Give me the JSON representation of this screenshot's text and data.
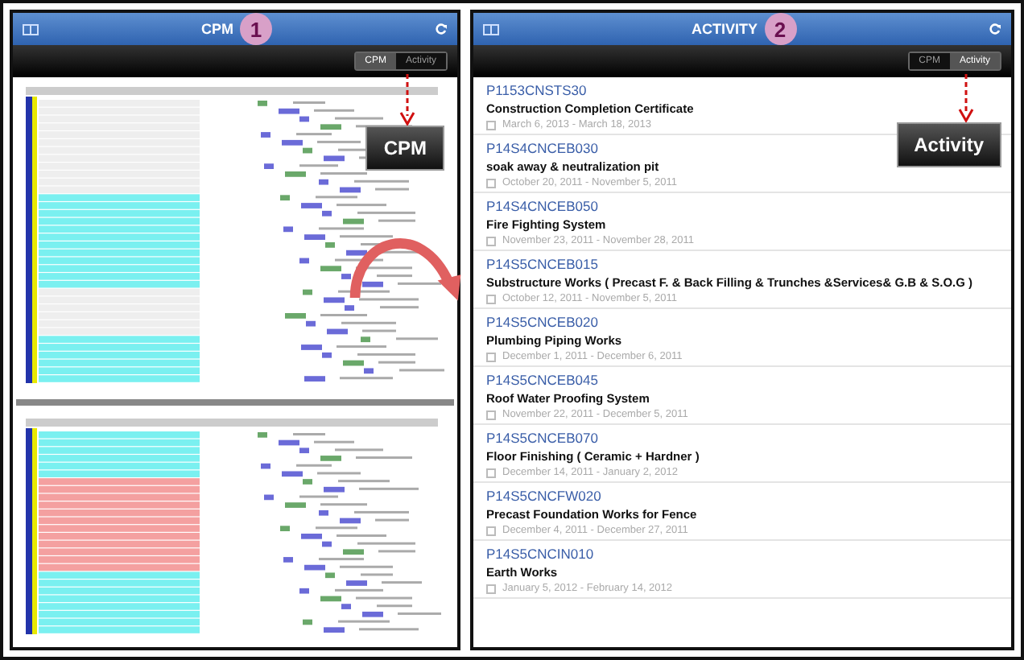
{
  "screens": [
    {
      "title": "CPM",
      "badge": "1",
      "segments": [
        {
          "label": "CPM",
          "selected": true
        },
        {
          "label": "Activity",
          "selected": false
        }
      ],
      "callout": "CPM"
    },
    {
      "title": "ACTIVITY",
      "badge": "2",
      "segments": [
        {
          "label": "CPM",
          "selected": false
        },
        {
          "label": "Activity",
          "selected": true
        }
      ],
      "callout": "Activity",
      "activities": [
        {
          "code": "P1153CNSTS30",
          "name": "Construction Completion Certificate",
          "dates": "March 6, 2013 - March 18, 2013"
        },
        {
          "code": "P14S4CNCEB030",
          "name": "soak away & neutralization pit",
          "dates": "October 20, 2011 - November 5, 2011"
        },
        {
          "code": "P14S4CNCEB050",
          "name": "Fire Fighting System",
          "dates": "November 23, 2011 - November 28, 2011"
        },
        {
          "code": "P14S5CNCEB015",
          "name": "Substructure Works ( Precast F. & Back Filling & Trunches &Services& G.B & S.O.G )",
          "dates": "October 12, 2011 - November 5, 2011"
        },
        {
          "code": "P14S5CNCEB020",
          "name": "Plumbing Piping  Works",
          "dates": "December 1, 2011 - December 6, 2011"
        },
        {
          "code": "P14S5CNCEB045",
          "name": "Roof Water Proofing System",
          "dates": "November 22, 2011 - December 5, 2011"
        },
        {
          "code": "P14S5CNCEB070",
          "name": "Floor Finishing ( Ceramic + Hardner )",
          "dates": "December 14, 2011 - January 2, 2012"
        },
        {
          "code": "P14S5CNCFW020",
          "name": "Precast Foundation Works for Fence",
          "dates": "December 4, 2011 - December 27, 2011"
        },
        {
          "code": "P14S5CNCIN010",
          "name": "Earth Works",
          "dates": "January 5, 2012 - February 14, 2012"
        }
      ]
    }
  ]
}
